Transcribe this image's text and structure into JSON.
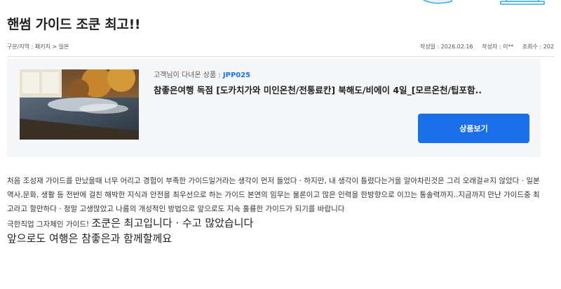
{
  "post": {
    "title": "핸썸 가이드 조쿤 최고!!",
    "breadcrumb": "구분/지역 : 패키지 > 일본",
    "date": "작성일 : 2026.02.16",
    "author": "작성자 : 이**",
    "views": "조회수 : 202"
  },
  "product": {
    "label_prefix": "고객님이 다녀온 상품 : ",
    "code": "JPP025",
    "name": "참좋은여행 독점 [도카치가와 미인온천/전통료칸] 북해도/비에이 4일_[모르온천/팁포함..",
    "button_label": "상품보기"
  },
  "review": {
    "paragraph": "처음 조성재 가이드를 만났을때 너무 어리고 경험이 부족한 가이드일거라는 생각이 먼저 들었다 · 하지만, 내 생각이 틀렸다는거을 알아차린것은 그리 오래걸ㄹ지 않았다 · 일본 역사,문화, 생활 등 전반에 걸친 해박한 지식과 안전을 최우선으로 하는 가이드 본연의 임무는 물론이고 많은 인력을 한방향으로 이끄는 통솔력까지..지금까지 만난 가이드중 최고라고 할만하다 · 정말 고생많았고 나름의 개성적인 방법으로 앞으로도 지속 훌륭한 가이드가 되기를 바랍니다",
    "line2_small": "극한직업 그자체인 가이드! ",
    "line2_big": "조쿤은 최고입니다  · 수고 많았습니다",
    "line3": "앞으로도 여행은 참좋은과 함께할께요"
  },
  "colors": {
    "accent": "#1a6fe8",
    "code": "#1a73e8",
    "box_bg": "#f5f6f8"
  }
}
